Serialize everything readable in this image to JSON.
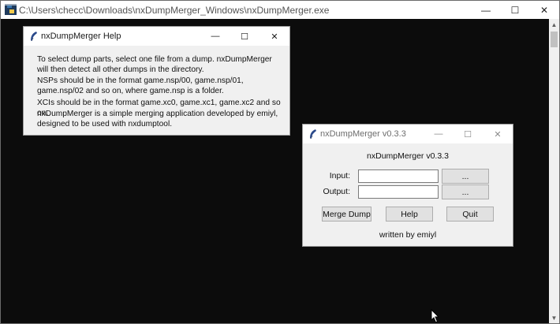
{
  "console": {
    "title": "C:\\Users\\checc\\Downloads\\nxDumpMerger_Windows\\nxDumpMerger.exe",
    "controls": {
      "minimize": "—",
      "maximize": "☐",
      "close": "✕"
    }
  },
  "help_window": {
    "title": "nxDumpMerger Help",
    "controls": {
      "minimize": "—",
      "maximize": "☐",
      "close": "✕"
    },
    "paragraphs": [
      "To select dump parts, select one file from a dump. nxDumpMerger will then detect all other dumps in the directory.",
      "NSPs should be in the format game.nsp/00, game.nsp/01, game.nsp/02 and so on, where game.nsp is a folder.",
      "XCIs should be in the format game.xc0, game.xc1, game.xc2 and so on.",
      "nxDumpMerger is a simple merging application developed by emiyl, designed to be used with nxdumptool."
    ]
  },
  "main_window": {
    "title": "nxDumpMerger v0.3.3",
    "controls": {
      "minimize": "—",
      "maximize": "☐",
      "close": "✕"
    },
    "heading": "nxDumpMerger v0.3.3",
    "input": {
      "label": "Input:",
      "value": "",
      "browse_label": "..."
    },
    "output": {
      "label": "Output:",
      "value": "",
      "browse_label": "..."
    },
    "buttons": {
      "merge": "Merge Dump",
      "help": "Help",
      "quit": "Quit"
    },
    "footer": "written by emiyl"
  },
  "colors": {
    "console_bg": "#0c0c0c",
    "dialog_bg": "#f0f0f0",
    "titlebar": "#ffffff",
    "button": "#e1e1e1"
  }
}
